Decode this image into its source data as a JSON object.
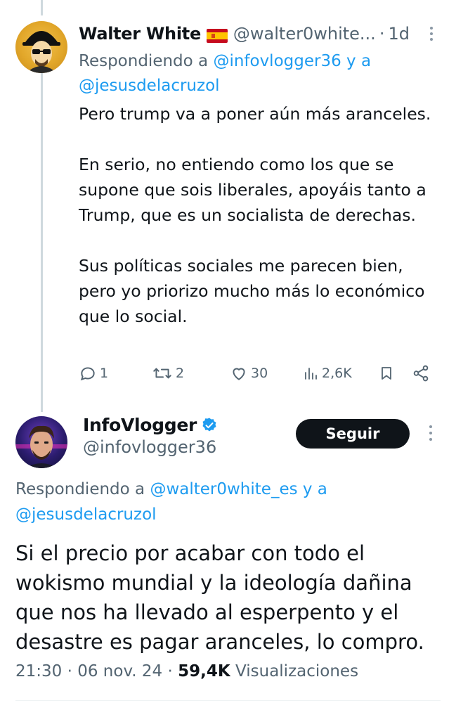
{
  "tweet1": {
    "name": "Walter White",
    "handle": "@walter0white...",
    "separator": "·",
    "time": "1d",
    "replying_prefix": "Respondiendo a ",
    "replying_user1": "@infovlogger36",
    "replying_and": " y a",
    "replying_user2": "@jesusdelacruzol",
    "body": "Pero trump va a poner aún más aranceles.\n\nEn serio, no entiendo como los que se supone que sois liberales, apoyáis tanto a Trump, que es un socialista de derechas.\n\nSus políticas sociales me parecen bien, pero yo priorizo mucho más lo económico que lo social.",
    "actions": {
      "replies": "1",
      "reposts": "2",
      "likes": "30",
      "views": "2,6K"
    }
  },
  "tweet2": {
    "name": "InfoVlogger",
    "handle": "@infovlogger36",
    "follow_label": "Seguir",
    "replying_prefix": "Respondiendo a ",
    "replying_user1": "@walter0white_es",
    "replying_and": " y a",
    "replying_user2": "@jesusdelacruzol",
    "body": "Si el precio  por acabar con todo el wokismo mundial y la ideología dañina que nos ha llevado al esperpento y el desastre es pagar aranceles, lo compro.",
    "time": "21:30",
    "date": "06 nov. 24",
    "views_count": "59,4K",
    "views_label": "Visualizaciones"
  },
  "colors": {
    "text": "#0f1419",
    "secondary": "#536471",
    "link": "#1d9bf0",
    "verified": "#1d9bf0",
    "follow_bg": "#0f1419"
  },
  "icons": [
    "reply-icon",
    "repost-icon",
    "like-icon",
    "views-icon",
    "bookmark-icon",
    "share-icon",
    "verified-badge-icon",
    "more-icon",
    "spain-flag-icon"
  ]
}
